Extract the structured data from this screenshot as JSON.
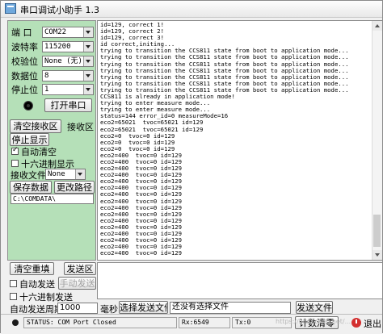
{
  "window": {
    "title": "串口调试小助手 1.3"
  },
  "settings": {
    "port": {
      "label": "端  口",
      "value": "COM22"
    },
    "baud": {
      "label": "波特率",
      "value": "115200"
    },
    "parity": {
      "label": "校验位",
      "value": "None (无)"
    },
    "databits": {
      "label": "数据位",
      "value": "8"
    },
    "stopbits": {
      "label": "停止位",
      "value": "1"
    }
  },
  "buttons": {
    "open_port": "打开串口",
    "clear_receive": "清空接收区",
    "receive_area": "接收区",
    "stop_display": "停止显示",
    "save_data": "保存数据",
    "change_path": "更改路径",
    "clear_resend": "清空重填",
    "send_area": "发送区",
    "manual_send": "手动发送",
    "select_send_file": "选择发送文件",
    "send_file": "发送文件",
    "reset_count": "计数清零",
    "exit": "退出"
  },
  "checkboxes": {
    "auto_clear": {
      "label": "自动清空",
      "checked": true
    },
    "hex_display": {
      "label": "十六进制显示",
      "checked": false
    },
    "auto_send": {
      "label": "自动发送",
      "checked": false
    },
    "hex_send": {
      "label": "十六进制发送",
      "checked": false
    }
  },
  "receive_file": {
    "label": "接收文件",
    "value": "None"
  },
  "save_path": "C:\\COMDATA\\",
  "auto_send_period": {
    "label": "自动发送周期",
    "value": "1000",
    "unit": "毫秒"
  },
  "file_status": "还没有选择文件",
  "receive_lines": [
    "id=129, correct 1!",
    "id=129, correct 2!",
    "id=129, correct 3!",
    "id correct,initing...",
    "trying to transition the CCS811 state from boot to application mode...",
    "trying to transition the CCS811 state from boot to application mode...",
    "trying to transition the CCS811 state from boot to application mode...",
    "trying to transition the CCS811 state from boot to application mode...",
    "trying to transition the CCS811 state from boot to application mode...",
    "trying to transition the CCS811 state from boot to application mode...",
    "trying to transition the CCS811 state from boot to application mode...",
    "CCS811 is already in application mode!",
    "trying to enter measure mode...",
    "trying to enter measure mode...",
    "status=144 error_id=0 measureMode=16",
    "eco2=65021  tvoc=65021 id=129",
    "eco2=65021  tvoc=65021 id=129",
    "eco2=0  tvoc=0 id=129",
    "eco2=0  tvoc=0 id=129",
    "eco2=0  tvoc=0 id=129",
    "eco2=400  tvoc=0 id=129",
    "eco2=400  tvoc=0 id=129",
    "eco2=400  tvoc=0 id=129",
    "eco2=400  tvoc=0 id=129",
    "eco2=400  tvoc=0 id=129",
    "eco2=400  tvoc=0 id=129",
    "eco2=400  tvoc=0 id=129",
    "eco2=400  tvoc=0 id=129",
    "eco2=400  tvoc=0 id=129",
    "eco2=400  tvoc=0 id=129",
    "eco2=400  tvoc=0 id=129",
    "eco2=400  tvoc=0 id=129",
    "eco2=400  tvoc=0 id=129",
    "eco2=400  tvoc=0 id=129",
    "eco2=400  tvoc=0 id=129",
    "eco2=400  tvoc=0 id=129"
  ],
  "status": {
    "port_status": "STATUS: COM Port Closed",
    "rx": "Rx:6549",
    "tx": "Tx:0"
  },
  "watermark": "https://blog.csdn.net/...",
  "icons": {
    "app": "serial-app-icon",
    "led": "port-status-led",
    "exit": "power-icon"
  },
  "colors": {
    "panel": "#b5e0b8"
  }
}
